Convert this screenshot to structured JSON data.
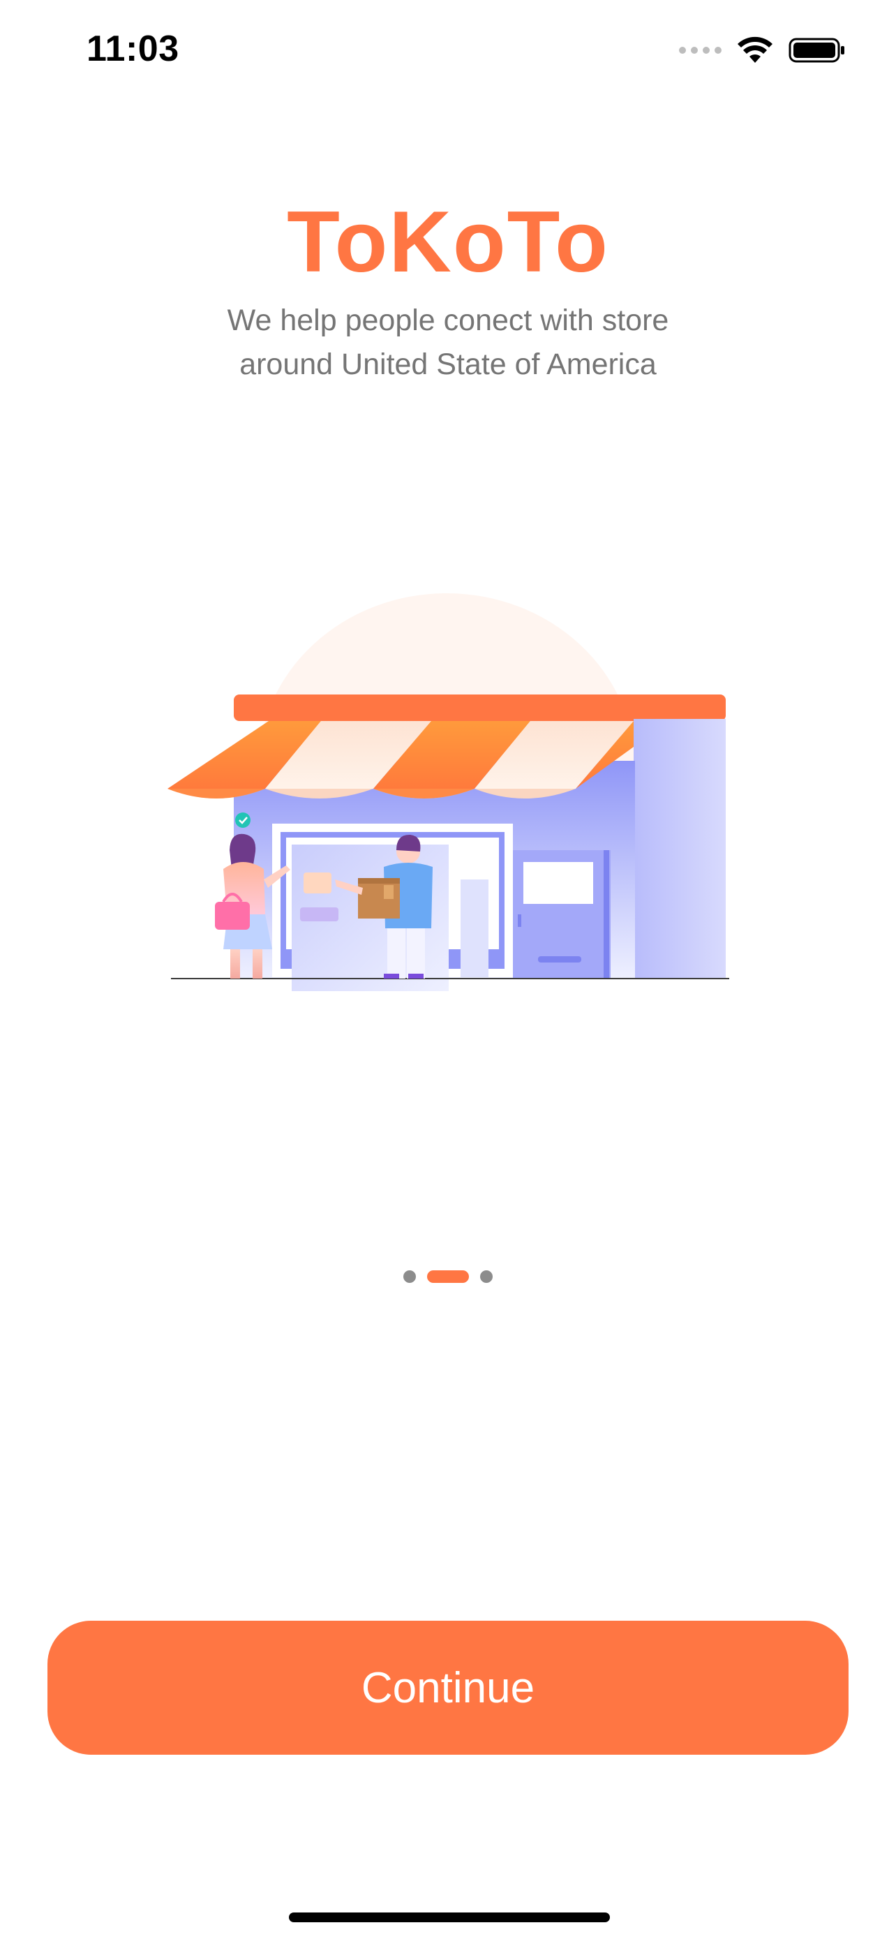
{
  "status_bar": {
    "time": "11:03",
    "icons": [
      "signal-icon",
      "wifi-icon",
      "battery-icon"
    ]
  },
  "header": {
    "title": "ToKoTo",
    "subtitle_lines": [
      "We help people conect with store",
      "around United State of America"
    ]
  },
  "illustration": {
    "name": "storefront-illustration"
  },
  "pager": {
    "count": 3,
    "active_index": 1
  },
  "actions": {
    "continue_label": "Continue"
  },
  "colors": {
    "primary": "#FF7643",
    "subtitle_text": "#757575",
    "inactive_dot": "#8C8C8C"
  }
}
